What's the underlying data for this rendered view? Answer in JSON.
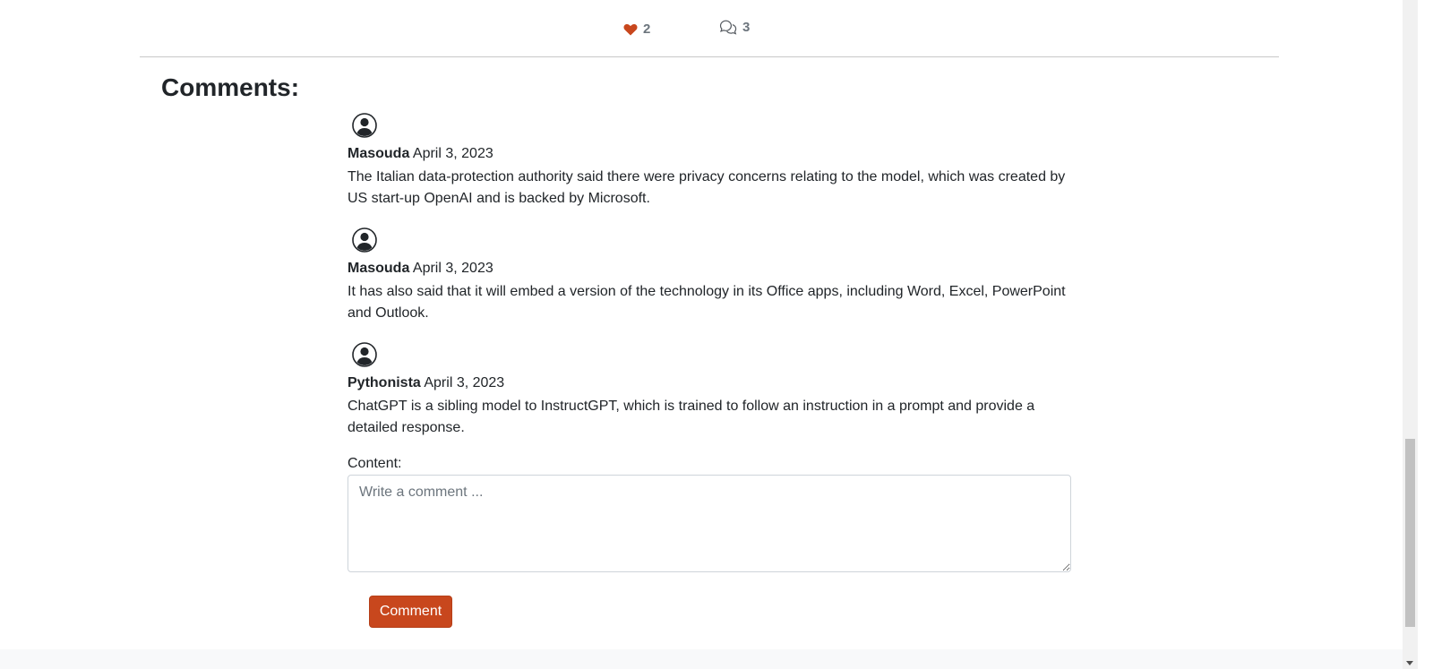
{
  "post_stats": {
    "likes_count": "2",
    "comments_count": "3",
    "heart_icon": "heart-icon",
    "comment_icon": "chat-bubbles-icon",
    "heart_color": "#c8471d"
  },
  "comments_section": {
    "heading": "Comments:",
    "items": [
      {
        "author": "Masouda",
        "date": "April 3, 2023",
        "body": "The Italian data-protection authority said there were privacy concerns relating to the model, which was created by US start-up OpenAI and is backed by Microsoft.",
        "avatar_icon": "user-avatar-icon"
      },
      {
        "author": "Masouda",
        "date": "April 3, 2023",
        "body": "It has also said that it will embed a version of the technology in its Office apps, including Word, Excel, PowerPoint and Outlook.",
        "avatar_icon": "user-avatar-icon"
      },
      {
        "author": "Pythonista",
        "date": "April 3, 2023",
        "body": "ChatGPT is a sibling model to InstructGPT, which is trained to follow an instruction in a prompt and provide a detailed response.",
        "avatar_icon": "user-avatar-icon"
      }
    ]
  },
  "comment_form": {
    "label": "Content:",
    "placeholder": "Write a comment ...",
    "value": "",
    "submit_label": "Comment",
    "button_color": "#c8471d"
  }
}
